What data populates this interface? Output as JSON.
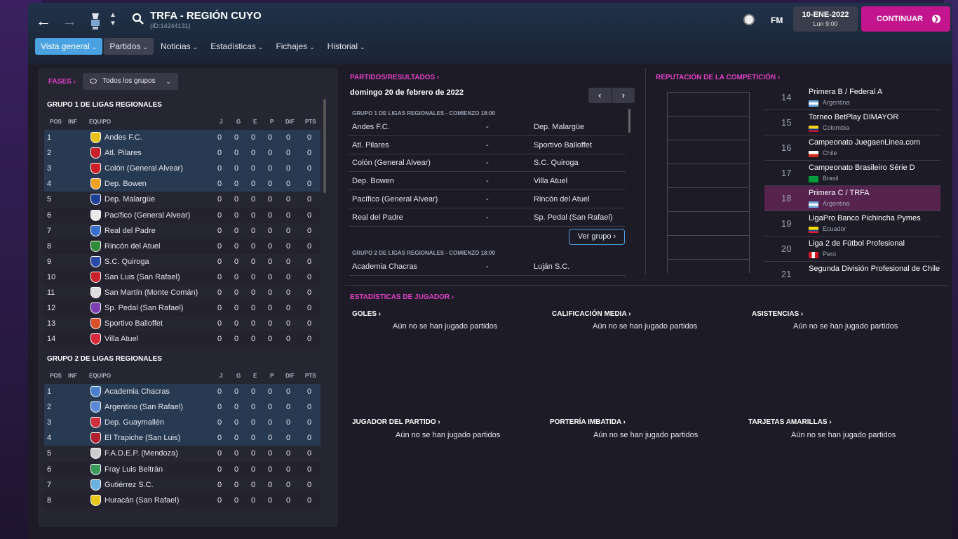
{
  "header": {
    "title": "TRFA - REGIÓN CUYO",
    "id": "(ID:14244131)",
    "fm": "FM",
    "date": "10-ENE-2022",
    "day": "Lun 9:00",
    "continue": "CONTINUAR"
  },
  "tabs": [
    {
      "label": "Vista general"
    },
    {
      "label": "Partidos"
    },
    {
      "label": "Noticias"
    },
    {
      "label": "Estadísticas"
    },
    {
      "label": "Fichajes"
    },
    {
      "label": "Historial"
    }
  ],
  "left": {
    "fases": "FASES",
    "group_filter": "Todos los grupos",
    "cols": {
      "pos": "POS",
      "inf": "INF",
      "team": "EQUIPO",
      "j": "J",
      "g": "G",
      "e": "E",
      "p": "P",
      "dif": "DIF",
      "pts": "PTS"
    },
    "group1": {
      "title": "GRUPO 1 DE LIGAS REGIONALES",
      "rows": [
        {
          "pos": "1",
          "team": "Andes F.C.",
          "j": "0",
          "g": "0",
          "e": "0",
          "p": "0",
          "dif": "0",
          "pts": "0",
          "q": true,
          "color": "#e8c31a"
        },
        {
          "pos": "2",
          "team": "Atl. Pilares",
          "j": "0",
          "g": "0",
          "e": "0",
          "p": "0",
          "dif": "0",
          "pts": "0",
          "q": true,
          "color": "#c8202a"
        },
        {
          "pos": "3",
          "team": "Colón (General Alvear)",
          "j": "0",
          "g": "0",
          "e": "0",
          "p": "0",
          "dif": "0",
          "pts": "0",
          "q": true,
          "color": "#d01f25"
        },
        {
          "pos": "4",
          "team": "Dep. Bowen",
          "j": "0",
          "g": "0",
          "e": "0",
          "p": "0",
          "dif": "0",
          "pts": "0",
          "q": true,
          "color": "#f0a020"
        },
        {
          "pos": "5",
          "team": "Dep. Malargüe",
          "j": "0",
          "g": "0",
          "e": "0",
          "p": "0",
          "dif": "0",
          "pts": "0",
          "q": false,
          "color": "#1f3f9a"
        },
        {
          "pos": "6",
          "team": "Pacífico (General Alvear)",
          "j": "0",
          "g": "0",
          "e": "0",
          "p": "0",
          "dif": "0",
          "pts": "0",
          "q": false,
          "color": "#e8e8e8"
        },
        {
          "pos": "7",
          "team": "Real del Padre",
          "j": "0",
          "g": "0",
          "e": "0",
          "p": "0",
          "dif": "0",
          "pts": "0",
          "q": false,
          "color": "#3a6fd0"
        },
        {
          "pos": "8",
          "team": "Rincón del Atuel",
          "j": "0",
          "g": "0",
          "e": "0",
          "p": "0",
          "dif": "0",
          "pts": "0",
          "q": false,
          "color": "#2f8a3a"
        },
        {
          "pos": "9",
          "team": "S.C. Quiroga",
          "j": "0",
          "g": "0",
          "e": "0",
          "p": "0",
          "dif": "0",
          "pts": "0",
          "q": false,
          "color": "#2b4aa8"
        },
        {
          "pos": "10",
          "team": "San Luis (San Rafael)",
          "j": "0",
          "g": "0",
          "e": "0",
          "p": "0",
          "dif": "0",
          "pts": "0",
          "q": false,
          "color": "#c8202a"
        },
        {
          "pos": "11",
          "team": "San Martín (Monte Comán)",
          "j": "0",
          "g": "0",
          "e": "0",
          "p": "0",
          "dif": "0",
          "pts": "0",
          "q": false,
          "color": "#dddddd"
        },
        {
          "pos": "12",
          "team": "Sp. Pedal (San Rafael)",
          "j": "0",
          "g": "0",
          "e": "0",
          "p": "0",
          "dif": "0",
          "pts": "0",
          "q": false,
          "color": "#7a3fb0"
        },
        {
          "pos": "13",
          "team": "Sportivo Balloffet",
          "j": "0",
          "g": "0",
          "e": "0",
          "p": "0",
          "dif": "0",
          "pts": "0",
          "q": false,
          "color": "#d8502a"
        },
        {
          "pos": "14",
          "team": "Villa Atuel",
          "j": "0",
          "g": "0",
          "e": "0",
          "p": "0",
          "dif": "0",
          "pts": "0",
          "q": false,
          "color": "#d82a3a"
        }
      ]
    },
    "group2": {
      "title": "GRUPO 2 DE LIGAS REGIONALES",
      "rows": [
        {
          "pos": "1",
          "team": "Academia Chacras",
          "j": "0",
          "g": "0",
          "e": "0",
          "p": "0",
          "dif": "0",
          "pts": "0",
          "q": true,
          "color": "#4a7fd0"
        },
        {
          "pos": "2",
          "team": "Argentino (San Rafael)",
          "j": "0",
          "g": "0",
          "e": "0",
          "p": "0",
          "dif": "0",
          "pts": "0",
          "q": true,
          "color": "#5a8ad8"
        },
        {
          "pos": "3",
          "team": "Dep. Guaymallén",
          "j": "0",
          "g": "0",
          "e": "0",
          "p": "0",
          "dif": "0",
          "pts": "0",
          "q": true,
          "color": "#d03040"
        },
        {
          "pos": "4",
          "team": "El Trapiche (San Luis)",
          "j": "0",
          "g": "0",
          "e": "0",
          "p": "0",
          "dif": "0",
          "pts": "0",
          "q": true,
          "color": "#b02030"
        },
        {
          "pos": "5",
          "team": "F.A.D.E.P. (Mendoza)",
          "j": "0",
          "g": "0",
          "e": "0",
          "p": "0",
          "dif": "0",
          "pts": "0",
          "q": false,
          "color": "#cccccc"
        },
        {
          "pos": "6",
          "team": "Fray Luis Beltrán",
          "j": "0",
          "g": "0",
          "e": "0",
          "p": "0",
          "dif": "0",
          "pts": "0",
          "q": false,
          "color": "#3a9a5a"
        },
        {
          "pos": "7",
          "team": "Gutiérrez S.C.",
          "j": "0",
          "g": "0",
          "e": "0",
          "p": "0",
          "dif": "0",
          "pts": "0",
          "q": false,
          "color": "#6ab0e0"
        },
        {
          "pos": "8",
          "team": "Huracán (San Rafael)",
          "j": "0",
          "g": "0",
          "e": "0",
          "p": "0",
          "dif": "0",
          "pts": "0",
          "q": false,
          "color": "#e8c81a"
        }
      ]
    }
  },
  "matches": {
    "title": "PARTIDOS/RESULTADOS",
    "date": "domingo 20 de febrero de 2022",
    "g1head": "GRUPO 1 DE LIGAS REGIONALES - COMIENZO 18:00",
    "g1": [
      {
        "home": "Andes F.C.",
        "sep": "-",
        "away": "Dep. Malargüe"
      },
      {
        "home": "Atl. Pilares",
        "sep": "-",
        "away": "Sportivo Balloffet"
      },
      {
        "home": "Colón (General Alvear)",
        "sep": "-",
        "away": "S.C. Quiroga"
      },
      {
        "home": "Dep. Bowen",
        "sep": "-",
        "away": "Villa Atuel"
      },
      {
        "home": "Pacífico (General Alvear)",
        "sep": "-",
        "away": "Rincón del Atuel"
      },
      {
        "home": "Real del Padre",
        "sep": "-",
        "away": "Sp. Pedal (San Rafael)"
      }
    ],
    "ver_grupo": "Ver grupo",
    "g2head": "GRUPO 2 DE LIGAS REGIONALES - COMIENZO 18:00",
    "g2": [
      {
        "home": "Academia Chacras",
        "sep": "-",
        "away": "Luján S.C."
      }
    ]
  },
  "reputation": {
    "title": "REPUTACIÓN DE LA COMPETICIÓN",
    "items": [
      {
        "rank": "14",
        "name": "Primera B / Federal A",
        "country": "Argentina",
        "flag": "ar",
        "hl": false
      },
      {
        "rank": "15",
        "name": "Torneo BetPlay DIMAYOR",
        "country": "Colombia",
        "flag": "co",
        "hl": false
      },
      {
        "rank": "16",
        "name": "Campeonato JuegaenLinea.com",
        "country": "Chile",
        "flag": "cl",
        "hl": false
      },
      {
        "rank": "17",
        "name": "Campeonato Brasileiro Série D",
        "country": "Brasil",
        "flag": "br",
        "hl": false
      },
      {
        "rank": "18",
        "name": "Primera C / TRFA",
        "country": "Argentina",
        "flag": "ar",
        "hl": true
      },
      {
        "rank": "19",
        "name": "LigaPro Banco Pichincha Pymes",
        "country": "Ecuador",
        "flag": "ec",
        "hl": false
      },
      {
        "rank": "20",
        "name": "Liga 2 de Fútbol Profesional",
        "country": "Perú",
        "flag": "pe",
        "hl": false
      },
      {
        "rank": "21",
        "name": "Segunda División Profesional de Chile",
        "country": "",
        "flag": "",
        "hl": false
      }
    ]
  },
  "stats": {
    "title": "ESTADÍSTICAS DE JUGADOR",
    "goles": "GOLES",
    "calif": "CALIFICACIÓN MEDIA",
    "asist": "ASISTENCIAS",
    "jugador": "JUGADOR DEL PARTIDO",
    "porteria": "PORTERÍA IMBATIDA",
    "tarjetas": "TARJETAS AMARILLAS",
    "empty": "Aún no se han jugado partidos"
  },
  "colors": {
    "accent": "#c2158e",
    "link": "#e040c6",
    "tab_active": "#4aa3e0"
  }
}
